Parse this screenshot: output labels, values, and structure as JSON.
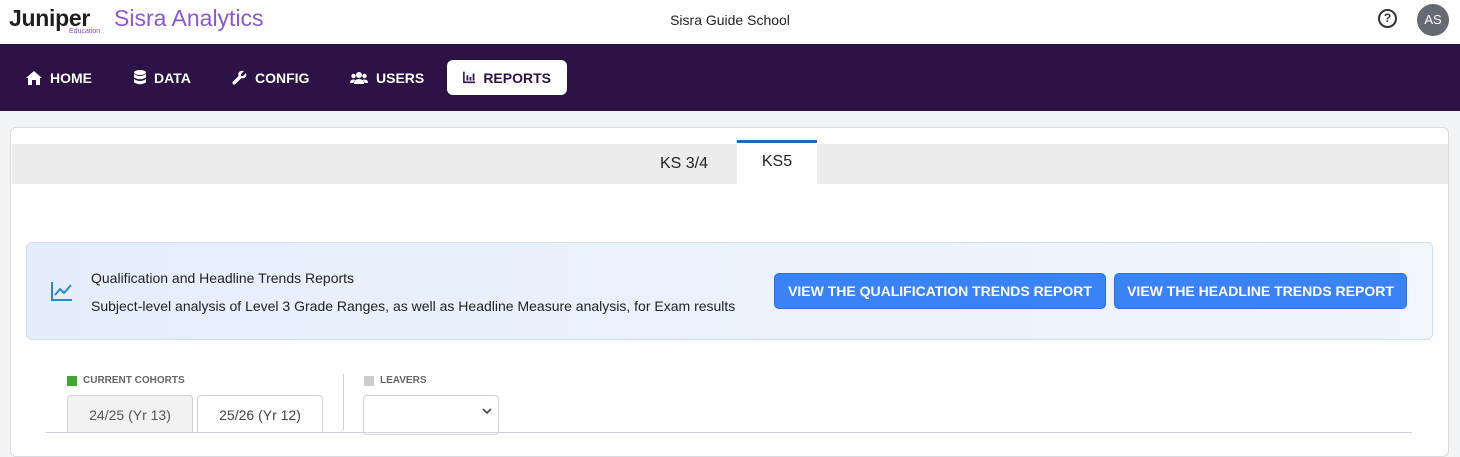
{
  "brand": {
    "name": "Juniper",
    "sub": "Education",
    "product": "Sisra Analytics"
  },
  "school": "Sisra Guide School",
  "avatar": "AS",
  "help": "?",
  "nav": [
    {
      "label": "HOME",
      "icon": "home-icon"
    },
    {
      "label": "DATA",
      "icon": "database-icon"
    },
    {
      "label": "CONFIG",
      "icon": "wrench-icon"
    },
    {
      "label": "USERS",
      "icon": "users-icon"
    },
    {
      "label": "REPORTS",
      "icon": "chart-icon"
    }
  ],
  "tabs": [
    {
      "label": "KS 3/4"
    },
    {
      "label": "KS5"
    }
  ],
  "banner": {
    "icon": "trend-line-icon",
    "title": "Qualification and Headline Trends Reports",
    "description": "Subject-level analysis of Level 3 Grade Ranges, as well as Headline Measure analysis, for Exam results",
    "btn_qual": "VIEW THE QUALIFICATION TRENDS REPORT",
    "btn_headline": "VIEW THE HEADLINE TRENDS REPORT"
  },
  "current_cohorts": {
    "label": "CURRENT COHORTS",
    "color": "#3fa535",
    "items": [
      "24/25 (Yr 13)",
      "25/26 (Yr 12)"
    ]
  },
  "leavers": {
    "label": "LEAVERS",
    "color": "#cccccc",
    "selected": ""
  }
}
